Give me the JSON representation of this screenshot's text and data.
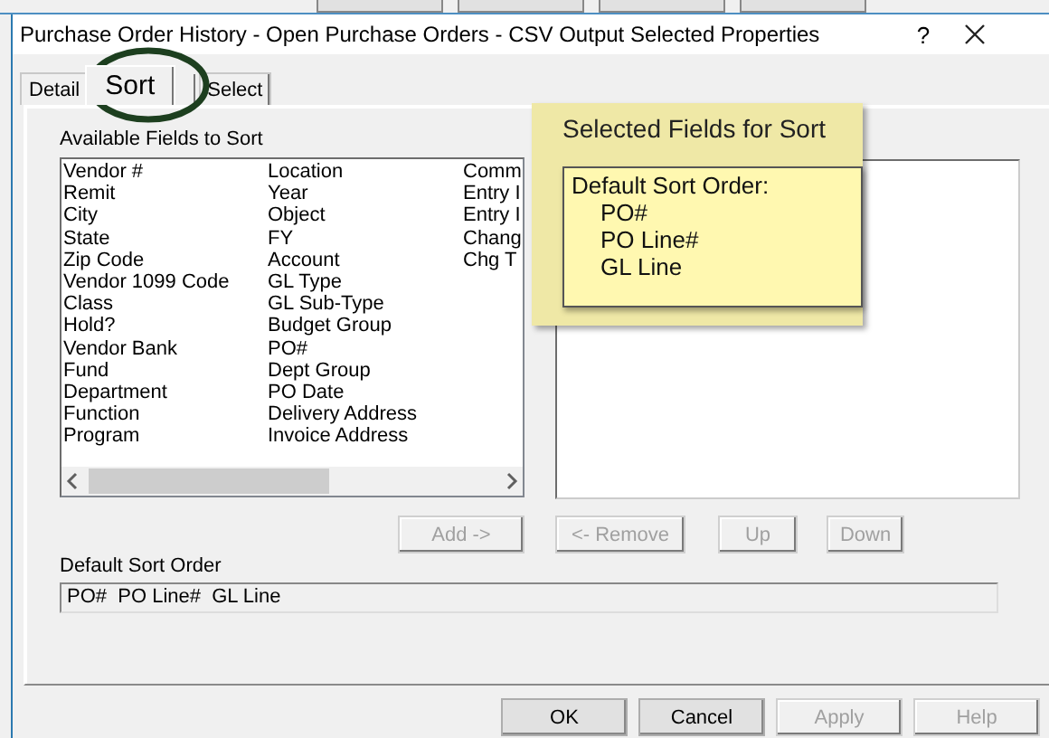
{
  "window": {
    "title": "Purchase Order History - Open Purchase Orders - CSV Output Selected Properties",
    "help_glyph": "?"
  },
  "tabs": [
    {
      "label": "Detail",
      "selected": false
    },
    {
      "label": "Sort",
      "selected": true
    },
    {
      "label": "Select",
      "selected": false
    }
  ],
  "available_fields": {
    "label": "Available Fields to Sort",
    "columns": [
      [
        "Vendor #",
        "Remit",
        "City",
        "State",
        "Zip Code",
        "Vendor 1099 Code",
        "Class",
        "Hold?",
        "Vendor Bank",
        "Fund",
        "Department",
        "Function",
        "Program"
      ],
      [
        "Location",
        "Year",
        "Object",
        "FY",
        "Account",
        "GL Type",
        "GL Sub-Type",
        "Budget Group",
        "PO#",
        "Dept Group",
        "PO Date",
        "Delivery Address",
        "Invoice Address"
      ],
      [
        "Comm",
        "Entry I",
        "Entry I",
        "Chang",
        "Chg T"
      ]
    ]
  },
  "callout": {
    "title": "Selected Fields for Sort",
    "heading": "Default Sort Order:",
    "items": [
      "PO#",
      "PO Line#",
      "GL Line"
    ]
  },
  "list_buttons": [
    {
      "label": "Add ->",
      "disabled": true
    },
    {
      "label": "<- Remove",
      "disabled": true
    },
    {
      "label": "Up",
      "disabled": true
    },
    {
      "label": "Down",
      "disabled": true
    }
  ],
  "default_sort_order": {
    "label": "Default Sort Order",
    "value": "PO#  PO Line#  GL Line"
  },
  "footer_buttons": [
    {
      "label": "OK",
      "disabled": false
    },
    {
      "label": "Cancel",
      "disabled": false
    },
    {
      "label": "Apply",
      "disabled": true
    },
    {
      "label": "Help",
      "disabled": true
    }
  ]
}
